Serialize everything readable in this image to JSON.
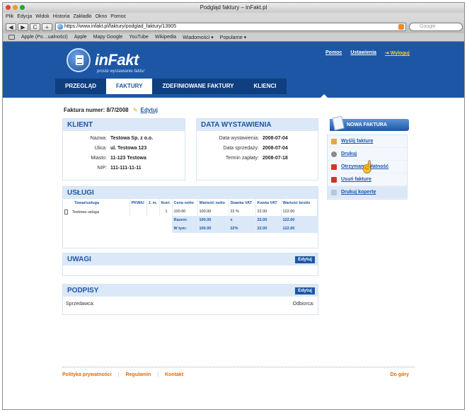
{
  "window": {
    "title": "Podgląd faktury – inFakt.pl"
  },
  "menu": [
    "Plik",
    "Edycja",
    "Widok",
    "Historia",
    "Zakładki",
    "Okno",
    "Pomoc"
  ],
  "toolbar": {
    "back": "◀",
    "forward": "▶",
    "reload": "C",
    "add": "+",
    "url": "https://www.infakt.pl/faktury/podglad_faktury/13905",
    "search_placeholder": "Google"
  },
  "bookmarks": [
    "Apple (Po…ualności)",
    "Apple",
    "Mapy Google",
    "YouTube",
    "Wikipedia",
    "Wiadomości ▾",
    "Popularne ▾"
  ],
  "header": {
    "logo": "inFakt",
    "tagline": "proste wystawianie faktur",
    "links": {
      "help": "Pomoc",
      "settings": "Ustawienia",
      "logout": "Wyloguj"
    },
    "tabs": [
      "PRZEGLĄD",
      "FAKTURY",
      "ZDEFINIOWANE FAKTURY",
      "KLIENCI"
    ],
    "active_tab": "FAKTURY"
  },
  "invoice": {
    "number_label": "Faktura numer: 8/7/2008",
    "edit_label": "Edytuj"
  },
  "client": {
    "heading": "KLIENT",
    "rows": [
      {
        "k": "Nazwa:",
        "v": "Testowa Sp. z o.o."
      },
      {
        "k": "Ulica:",
        "v": "ul. Testowa 123"
      },
      {
        "k": "Miasto:",
        "v": "11-123 Testowa"
      },
      {
        "k": "NIP:",
        "v": "111-111-11-11"
      }
    ]
  },
  "dates": {
    "heading": "DATA WYSTAWIENIA",
    "rows": [
      {
        "k": "Data wystawienia:",
        "v": "2008-07-04"
      },
      {
        "k": "Data sprzedaży:",
        "v": "2008-07-04"
      },
      {
        "k": "Termin zapłaty:",
        "v": "2008-07-18"
      }
    ]
  },
  "services": {
    "heading": "USŁUGI",
    "columns": [
      "Towar/usługa",
      "PKWiU",
      "J. m.",
      "Ilość",
      "Cena netto",
      "Wartość netto",
      "Stawka VAT",
      "Kwota VAT",
      "Wartość brutto"
    ],
    "rows": [
      [
        "Testowa usługa",
        "",
        "",
        "1",
        "100.00",
        "100.00",
        "22 %",
        "22.00",
        "122.00"
      ]
    ],
    "totals": [
      [
        "Razem:",
        "100.00",
        "x",
        "22.00",
        "122.00"
      ],
      [
        "W tym:",
        "100.00",
        "22%",
        "22.00",
        "122.00"
      ]
    ]
  },
  "notes": {
    "heading": "UWAGI",
    "edit_label": "Edytuj"
  },
  "signatures": {
    "heading": "PODPISY",
    "edit_label": "Edytuj",
    "seller": "Sprzedawca:",
    "buyer": "Odbiorca:"
  },
  "sidebar": {
    "new_invoice": "NOWA FAKTURA",
    "actions": [
      "Wyślij fakturę",
      "Drukuj",
      "Otrzymano płatność",
      "Usuń fakturę",
      "Drukuj kopertę"
    ]
  },
  "footer": {
    "links": [
      "Polityka prywatności",
      "Regulamin",
      "Kontakt"
    ],
    "top": "Do góry"
  },
  "colors": {
    "brand_blue": "#1d56a5",
    "nav_dark": "#0f3f7e",
    "panel_bg": "#dbe8f7",
    "footer_orange": "#e66a00",
    "logout_yellow": "#ffcc33"
  }
}
